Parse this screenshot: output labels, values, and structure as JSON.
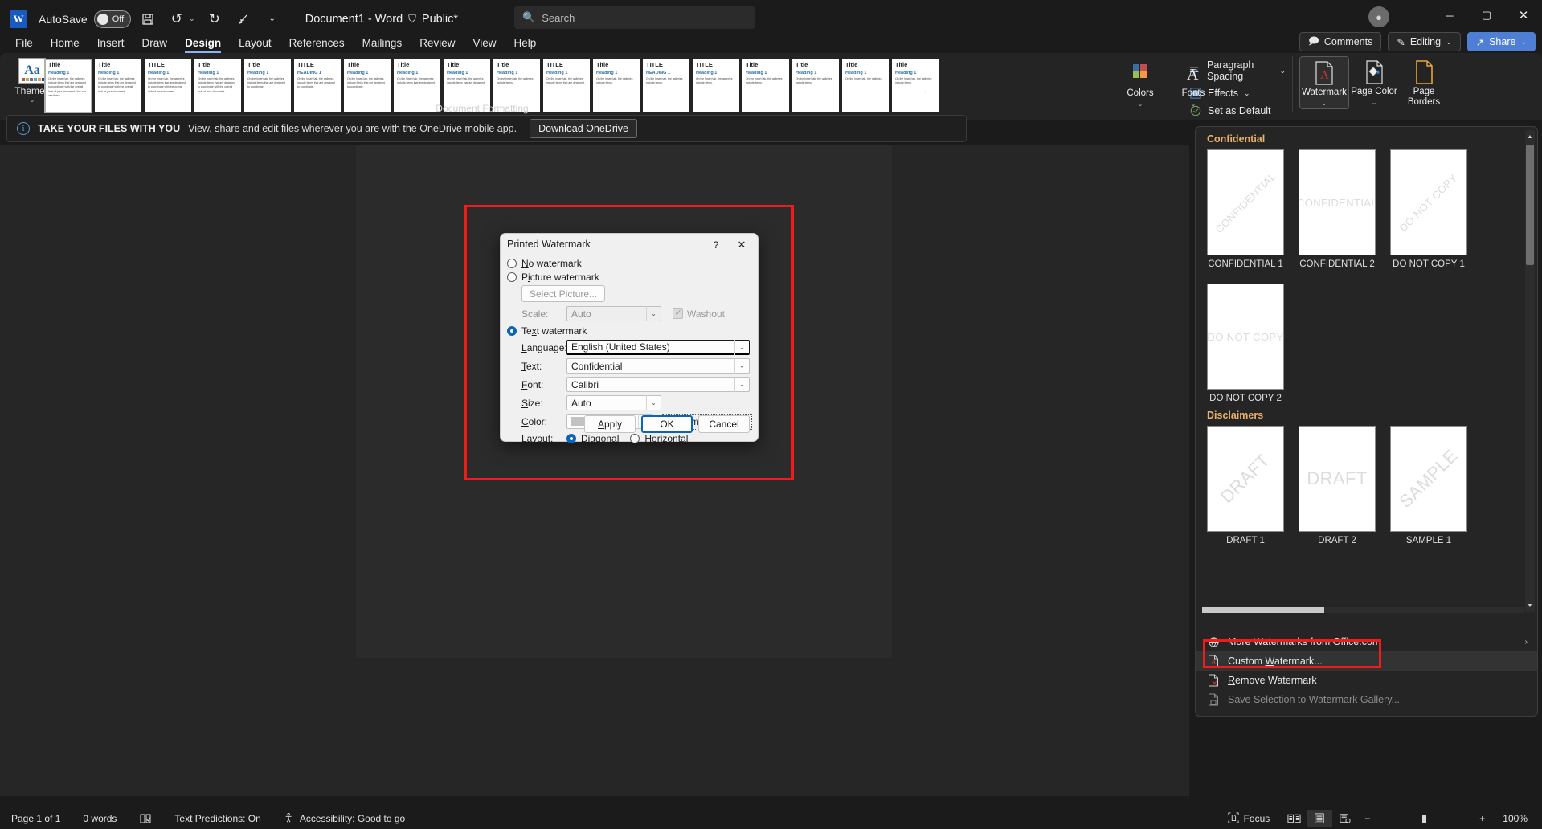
{
  "titlebar": {
    "app_logo": "word-logo",
    "autosave_label": "AutoSave",
    "autosave_state": "Off",
    "save_icon": "save-icon",
    "undo_icon": "undo-icon",
    "redo_icon": "redo-icon",
    "draw_icon": "pen-icon",
    "customize_icon": "customize-quick-access-icon",
    "document_title": "Document1  -  Word",
    "sensitivity_label": "Public*",
    "minimize": "minimize-icon",
    "maximize": "maximize-icon",
    "close": "close-icon"
  },
  "search": {
    "placeholder": "Search",
    "icon": "search-icon"
  },
  "tabs": [
    {
      "label": "File",
      "active": false
    },
    {
      "label": "Home",
      "active": false
    },
    {
      "label": "Insert",
      "active": false
    },
    {
      "label": "Draw",
      "active": false
    },
    {
      "label": "Design",
      "active": true
    },
    {
      "label": "Layout",
      "active": false
    },
    {
      "label": "References",
      "active": false
    },
    {
      "label": "Mailings",
      "active": false
    },
    {
      "label": "Review",
      "active": false
    },
    {
      "label": "View",
      "active": false
    },
    {
      "label": "Help",
      "active": false
    }
  ],
  "header_right": {
    "comments": "Comments",
    "editing": "Editing",
    "share": "Share"
  },
  "ribbon": {
    "themes_label": "Themes",
    "group_label": "Document Formatting",
    "style_gallery": [
      {
        "title": "Title",
        "heading": "Heading 1",
        "body": "On the Insert tab, the galleries include items that are designed to coordinate with the overall look of your document. You can use these"
      },
      {
        "title": "Title",
        "heading": "Heading 1",
        "body": "On the Insert tab, the galleries include items that are designed to coordinate with the overall look of your document."
      },
      {
        "title": "TITLE",
        "heading": "Heading 1",
        "body": "On the Insert tab, the galleries include items that are designed to coordinate with the overall look of your document."
      },
      {
        "title": "Title",
        "heading": "Heading 1",
        "body": "On the Insert tab, the galleries include items that are designed to coordinate with the overall look of your document."
      },
      {
        "title": "Title",
        "heading": "Heading 1",
        "body": "On the Insert tab, the galleries include items that are designed to coordinate."
      },
      {
        "title": "TITLE",
        "heading": "HEADING 1",
        "body": "On the Insert tab, the galleries include items that are designed to coordinate."
      },
      {
        "title": "Title",
        "heading": "Heading 1",
        "body": "On the Insert tab, the galleries include items that are designed to coordinate."
      },
      {
        "title": "Title",
        "heading": "Heading 1",
        "body": "On the Insert tab, the galleries include items that are designed."
      },
      {
        "title": "Title",
        "heading": "Heading 1",
        "body": "On the Insert tab, the galleries include items that are designed."
      },
      {
        "title": "Title",
        "heading": "Heading 1",
        "body": "On the Insert tab, the galleries include items."
      },
      {
        "title": "TITLE",
        "heading": "Heading 1",
        "body": "On the Insert tab, the galleries include items that are designed."
      },
      {
        "title": "Title",
        "heading": "Heading 1",
        "body": "On the Insert tab, the galleries include items."
      },
      {
        "title": "TITLE",
        "heading": "HEADING 1",
        "body": "On the Insert tab, the galleries include items."
      },
      {
        "title": "TITLE",
        "heading": "Heading 1",
        "body": "On the Insert tab, the galleries include items."
      },
      {
        "title": "Title",
        "heading": "Heading 1",
        "body": "On the Insert tab, the galleries include items."
      },
      {
        "title": "Title",
        "heading": "Heading 1",
        "body": "On the Insert tab, the galleries include items."
      },
      {
        "title": "Title",
        "heading": "Heading 1",
        "body": "On the Insert tab, the galleries."
      },
      {
        "title": "Title",
        "heading": "Heading 1",
        "body": "On the Insert tab, the galleries include items."
      }
    ],
    "paragraph_spacing": "Paragraph Spacing",
    "effects": "Effects",
    "set_as_default": "Set as Default",
    "watermark": "Watermark",
    "page_color": "Page Color",
    "page_borders": "Page Borders",
    "colors": "Colors",
    "fonts": "Fonts"
  },
  "onedrive_bar": {
    "headline": "TAKE YOUR FILES WITH YOU",
    "message": "View, share and edit files wherever you are with the OneDrive mobile app.",
    "button": "Download OneDrive",
    "info_icon": "info-icon"
  },
  "dialog": {
    "title": "Printed Watermark",
    "help_icon": "help-icon",
    "close_icon": "close-icon",
    "no_watermark": "No watermark",
    "picture_watermark": "Picture watermark",
    "select_picture": "Select Picture...",
    "scale_label": "Scale:",
    "scale_value": "Auto",
    "washout_label": "Washout",
    "washout_checked": true,
    "text_watermark": "Text watermark",
    "language_label": "Language:",
    "language_value": "English (United States)",
    "text_label": "Text:",
    "text_value": "Confidential",
    "font_label": "Font:",
    "font_value": "Calibri",
    "size_label": "Size:",
    "size_value": "Auto",
    "color_label": "Color:",
    "color_value": "#c2c2c2",
    "semitransparent_label": "Semitransparent",
    "semitransparent_checked": true,
    "layout_label": "Layout:",
    "layout_diagonal": "Diagonal",
    "layout_horizontal": "Horizontal",
    "layout_selected": "Diagonal",
    "selected_mode": "Text watermark",
    "apply": "Apply",
    "ok": "OK",
    "cancel": "Cancel"
  },
  "watermark_gallery": {
    "categories": [
      {
        "name": "Confidential",
        "items": [
          {
            "caption": "CONFIDENTIAL 1",
            "word": "CONFIDENTIAL",
            "orientation": "diagonal"
          },
          {
            "caption": "CONFIDENTIAL 2",
            "word": "CONFIDENTIAL",
            "orientation": "horizontal"
          },
          {
            "caption": "DO NOT COPY 1",
            "word": "DO NOT COPY",
            "orientation": "diagonal"
          },
          {
            "caption": "DO NOT COPY 2",
            "word": "DO NOT COPY",
            "orientation": "horizontal"
          }
        ]
      },
      {
        "name": "Disclaimers",
        "items": [
          {
            "caption": "DRAFT 1",
            "word": "DRAFT",
            "orientation": "diagonal"
          },
          {
            "caption": "DRAFT 2",
            "word": "DRAFT",
            "orientation": "horizontal"
          },
          {
            "caption": "SAMPLE 1",
            "word": "SAMPLE",
            "orientation": "diagonal"
          }
        ]
      }
    ],
    "menu": [
      {
        "label": "More Watermarks from Office.com",
        "icon": "globe-icon",
        "disabled": false,
        "submenu": true,
        "highlighted": false
      },
      {
        "label": "Custom Watermark...",
        "icon": "custom-watermark-icon",
        "disabled": false,
        "submenu": false,
        "highlighted": true
      },
      {
        "label": "Remove Watermark",
        "icon": "remove-watermark-icon",
        "disabled": false,
        "submenu": false,
        "highlighted": false
      },
      {
        "label": "Save Selection to Watermark Gallery...",
        "icon": "save-watermark-icon",
        "disabled": true,
        "submenu": false,
        "highlighted": false
      }
    ]
  },
  "statusbar": {
    "page": "Page 1 of 1",
    "words": "0 words",
    "proofing_icon": "proofing-icon",
    "text_predictions": "Text Predictions: On",
    "accessibility": "Accessibility: Good to go",
    "focus": "Focus",
    "view_read": "read-mode-icon",
    "view_print": "print-layout-icon",
    "view_web": "web-layout-icon",
    "zoom_out": "−",
    "zoom_in": "+",
    "zoom_level": "100%"
  },
  "colors": {
    "accent_blue": "#0a64b8",
    "annotation_red": "#f21b1b",
    "category_orange": "#e8b06a",
    "share_blue": "#4f7fd4"
  }
}
